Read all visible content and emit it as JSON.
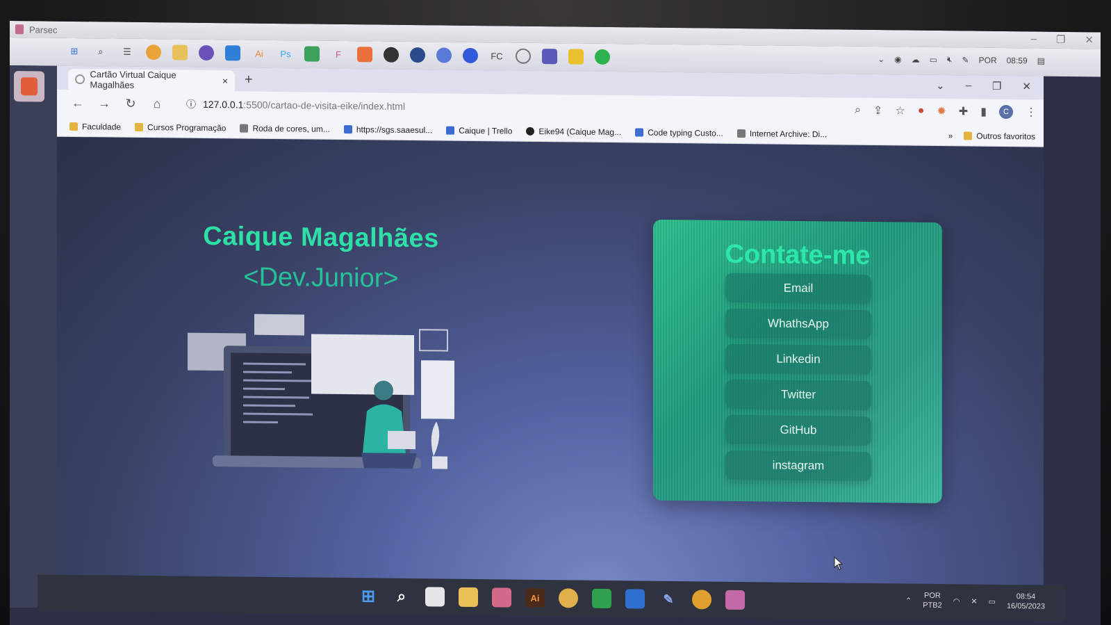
{
  "parsec": {
    "title": "Parsec"
  },
  "remote_tray_top": {
    "lang": "POR",
    "time": "08:59"
  },
  "browser": {
    "tab_title": "Cartão Virtual Caique Magalhães",
    "tab_close": "×",
    "new_tab": "+",
    "url_host": "127.0.0.1",
    "url_path": ":5500/cartao-de-visita-eike/index.html",
    "avatar_letter": "C"
  },
  "bookmarks": [
    {
      "label": "Faculdade"
    },
    {
      "label": "Cursos Programação"
    },
    {
      "label": "Roda de cores, um..."
    },
    {
      "label": "https://sgs.saaesul..."
    },
    {
      "label": "Caique | Trello"
    },
    {
      "label": "Eike94 (Caique Mag..."
    },
    {
      "label": "Code typing Custo..."
    },
    {
      "label": "Internet Archive: Di..."
    }
  ],
  "bookmarks_more": "»",
  "bookmarks_other": "Outros favoritos",
  "hero": {
    "name": "Caique Magalhães",
    "role": "<Dev.Junior>"
  },
  "contact": {
    "title": "Contate-me",
    "links": [
      "Email",
      "WhathsApp",
      "Linkedin",
      "Twitter",
      "GitHub",
      "instagram"
    ]
  },
  "taskbar": {
    "apps": [
      "windows-start",
      "search",
      "task-view",
      "file-explorer",
      "app-pink",
      "illustrator",
      "chrome",
      "app-green",
      "outlook",
      "app-pen",
      "chrome-canary",
      "parsec"
    ],
    "illustrator_label": "Ai",
    "lang": "POR",
    "lang_sub": "PTB2",
    "time": "08:54",
    "date": "16/05/2023"
  },
  "colors": {
    "accent": "#2ee0a8",
    "card_green": "#1d9b7c",
    "page_bg": "#3a4266"
  }
}
